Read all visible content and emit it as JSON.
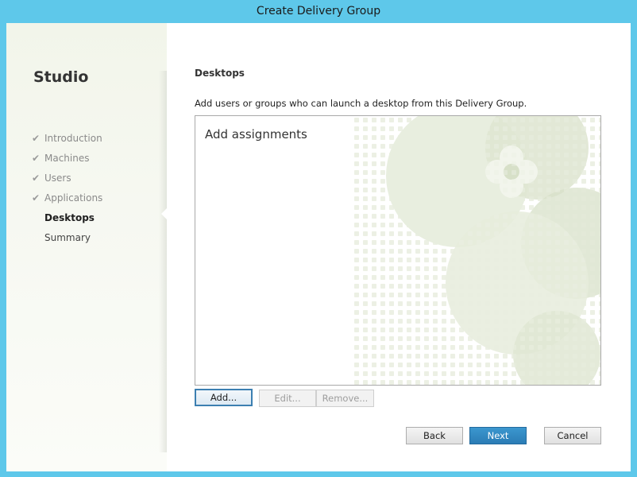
{
  "window": {
    "title": "Create Delivery Group"
  },
  "sidebar": {
    "app_title": "Studio",
    "steps": [
      {
        "label": "Introduction",
        "status": "completed"
      },
      {
        "label": "Machines",
        "status": "completed"
      },
      {
        "label": "Users",
        "status": "completed"
      },
      {
        "label": "Applications",
        "status": "completed"
      },
      {
        "label": "Desktops",
        "status": "current"
      },
      {
        "label": "Summary",
        "status": "upcoming"
      }
    ],
    "check_glyph": "✔"
  },
  "main": {
    "heading": "Desktops",
    "instructions": "Add users or groups who can launch a desktop from this Delivery Group.",
    "assignments_title": "Add assignments",
    "buttons": {
      "add": "Add...",
      "edit": "Edit...",
      "remove": "Remove..."
    }
  },
  "footer": {
    "back": "Back",
    "next": "Next",
    "cancel": "Cancel"
  },
  "colors": {
    "frame": "#5ec8ea",
    "accent": "#2b7cb5",
    "watermark": "#dfe6d2"
  }
}
